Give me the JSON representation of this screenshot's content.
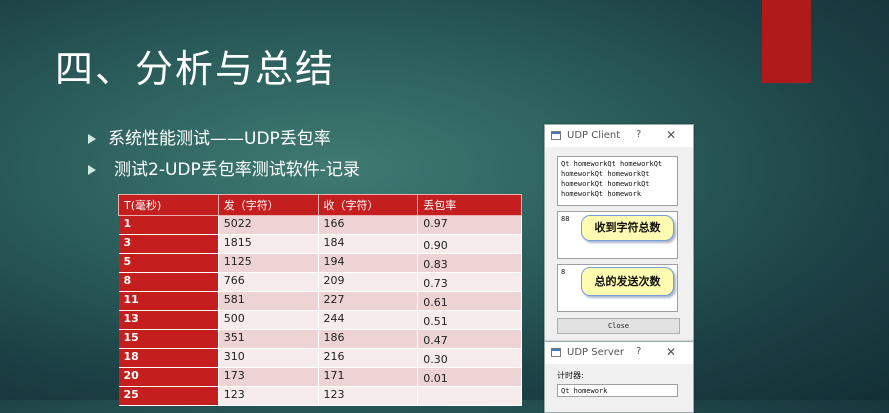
{
  "slide": {
    "title": "四、分析与总结",
    "bullets": [
      "系统性能测试——UDP丢包率",
      "测试2-UDP丢包率测试软件-记录"
    ]
  },
  "table": {
    "headers": [
      "T(毫秒)",
      "发（字符）",
      "收（字符）",
      "丢包率"
    ],
    "rows": [
      [
        "1",
        "5022",
        "166",
        "0.97"
      ],
      [
        "3",
        "1815",
        "184",
        "0.90"
      ],
      [
        "5",
        "1125",
        "194",
        "0.83"
      ],
      [
        "8",
        "766",
        "209",
        "0.73"
      ],
      [
        "11",
        "581",
        "227",
        "0.61"
      ],
      [
        "13",
        "500",
        "244",
        "0.51"
      ],
      [
        "15",
        "351",
        "186",
        "0.47"
      ],
      [
        "18",
        "310",
        "216",
        "0.30"
      ],
      [
        "20",
        "173",
        "171",
        "0.01"
      ],
      [
        "25",
        "123",
        "123",
        ""
      ]
    ]
  },
  "udp_client": {
    "title": "UDP Client",
    "help": "?",
    "close_x": "✕",
    "log_lines": [
      "Qt homeworkQt homeworkQt",
      "homeworkQt homeworkQt",
      "homeworkQt homeworkQt",
      "homeworkQt homework"
    ],
    "total_chars": "88",
    "total_chars_callout": "收到字符总数",
    "send_count": "8",
    "send_count_callout": "总的发送次数",
    "close_button": "Close"
  },
  "udp_server": {
    "title": "UDP Server",
    "help": "?",
    "close_x": "✕",
    "timer_label": "计时器:",
    "message": "Qt homework"
  },
  "colors": {
    "accent_red": "#c41e1e",
    "callout_fill": "#fffbb0"
  }
}
